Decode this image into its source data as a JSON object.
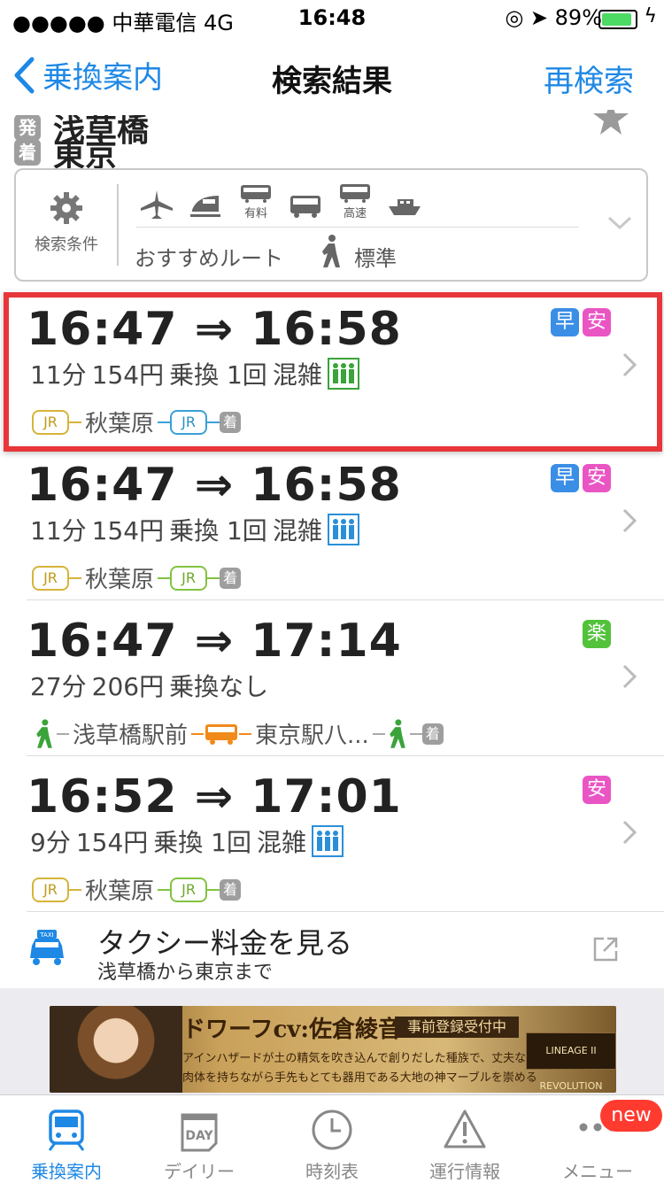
{
  "status_bar": {
    "carrier": "●●●●● 中華電信  4G",
    "time": "16:48",
    "right": "◎ ➤ 89%"
  },
  "nav": {
    "back_label": "乗換案内",
    "title": "検索結果",
    "research_label": "再検索"
  },
  "route": {
    "from_tag": "発",
    "from": "浅草橋",
    "to_tag": "着",
    "to": "東京"
  },
  "conditions": {
    "label": "検索条件",
    "modes": [
      {
        "icon": "airplane-icon",
        "label": ""
      },
      {
        "icon": "shinkansen-icon",
        "label": ""
      },
      {
        "icon": "limited-express-icon",
        "label": "有料"
      },
      {
        "icon": "bus-icon",
        "label": ""
      },
      {
        "icon": "highway-bus-icon",
        "label": "高速"
      },
      {
        "icon": "ferry-icon",
        "label": ""
      }
    ],
    "recommend": "おすすめルート",
    "walk_speed": "標準"
  },
  "results": [
    {
      "time": "16:47 ⇒ 16:58",
      "duration": "11分",
      "fare": "154円",
      "transfer": "乗換 1回",
      "crowd": "混雑",
      "crowd_color": "#3aa33a",
      "badges": [
        "早",
        "安"
      ],
      "route": {
        "line1": "JR",
        "station": "秋葉原",
        "line2": "JR",
        "arrive": "着"
      }
    },
    {
      "time": "16:47 ⇒ 16:58",
      "duration": "11分",
      "fare": "154円",
      "transfer": "乗換 1回",
      "crowd": "混雑",
      "crowd_color": "#2b8fd8",
      "badges": [
        "早",
        "安"
      ],
      "route": {
        "line1": "JR",
        "station": "秋葉原",
        "line2": "JR",
        "arrive": "着"
      }
    },
    {
      "time": "16:47 ⇒ 17:14",
      "duration": "27分",
      "fare": "206円",
      "transfer": "乗換なし",
      "badges": [
        "楽"
      ],
      "route": {
        "station": "浅草橋駅前",
        "station2": "東京駅八...",
        "arrive": "着"
      }
    },
    {
      "time": "16:52 ⇒ 17:01",
      "duration": "9分",
      "fare": "154円",
      "transfer": "乗換 1回",
      "crowd": "混雑",
      "crowd_color": "#2b8fd8",
      "badges": [
        "安"
      ],
      "route": {
        "line1": "JR",
        "station": "秋葉原",
        "line2": "JR",
        "arrive": "着"
      }
    }
  ],
  "taxi": {
    "title": "タクシー料金を見る",
    "subtitle": "浅草橋から東京まで",
    "icon_text": "TAXI"
  },
  "ad": {
    "headline": "ドワーフcv:佐倉綾音",
    "preregister": "事前登録受付中",
    "desc1": "アインハザードが土の精気を吹き込んで創りだした種族で、丈夫な",
    "desc2": "肉体を持ちながら手先もとても器用である大地の神マーブルを崇める",
    "logo": "LINEAGE II REVOLUTION"
  },
  "tabbar": {
    "tabs": [
      {
        "label": "乗換案内",
        "icon": "train-icon"
      },
      {
        "label": "デイリー",
        "icon": "calendar-day-icon",
        "icon_text": "DAY"
      },
      {
        "label": "時刻表",
        "icon": "clock-icon"
      },
      {
        "label": "運行情報",
        "icon": "warning-icon"
      },
      {
        "label": "メニュー",
        "icon": "more-icon"
      }
    ],
    "new_badge": "new"
  },
  "colors": {
    "accent": "#1e88e5",
    "highlight": "#e8363a"
  }
}
